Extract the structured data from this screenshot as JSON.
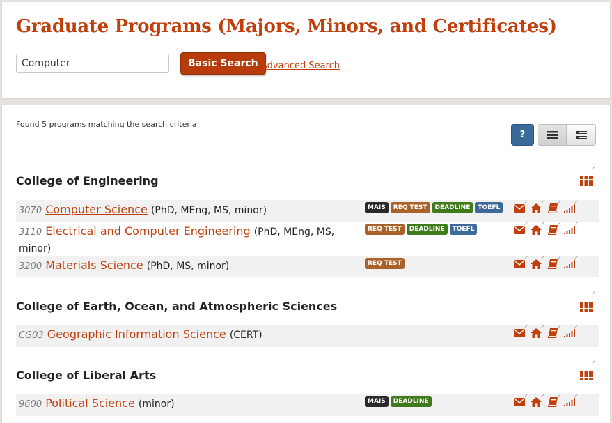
{
  "header": {
    "title": "Graduate Programs (Majors, Minors, and Certificates)",
    "search_value": "Computer",
    "basic_search_label": "Basic Search",
    "advanced_search_label": "Advanced Search"
  },
  "results": {
    "summary": "Found 5 programs matching the search criteria.",
    "help_label": "?",
    "colleges": [
      {
        "name": "College of Engineering",
        "programs": [
          {
            "code": "3070",
            "name": "Computer Science",
            "degrees": "(PhD, MEng, MS, minor)",
            "badges": [
              "MAIS",
              "REQ TEST",
              "DEADLINE",
              "TOEFL"
            ]
          },
          {
            "code": "3110",
            "name": "Electrical and Computer Engineering",
            "degrees": "(PhD, MEng, MS, minor)",
            "badges": [
              "REQ TEST",
              "DEADLINE",
              "TOEFL"
            ]
          },
          {
            "code": "3200",
            "name": "Materials Science",
            "degrees": "(PhD, MS, minor)",
            "badges": [
              "REQ TEST"
            ]
          }
        ]
      },
      {
        "name": "College of Earth, Ocean, and Atmospheric Sciences",
        "programs": [
          {
            "code": "CG03",
            "name": "Geographic Information Science",
            "degrees": "(CERT)",
            "badges": []
          }
        ]
      },
      {
        "name": "College of Liberal Arts",
        "programs": [
          {
            "code": "9600",
            "name": "Political Science",
            "degrees": "(minor)",
            "badges": [
              "MAIS",
              "DEADLINE"
            ]
          }
        ]
      }
    ]
  },
  "icons": {
    "action_icons": [
      "envelope-icon",
      "home-icon",
      "book-icon",
      "signal-bars-icon"
    ],
    "grid_icon": "grid-icon"
  },
  "colors": {
    "accent": "#c0400d",
    "button": "#b83c0b",
    "help": "#3a6a9a",
    "mais": "#2a2a2a",
    "req_test": "#a8622a",
    "deadline": "#3f7a1b",
    "toefl": "#3d6a98"
  }
}
